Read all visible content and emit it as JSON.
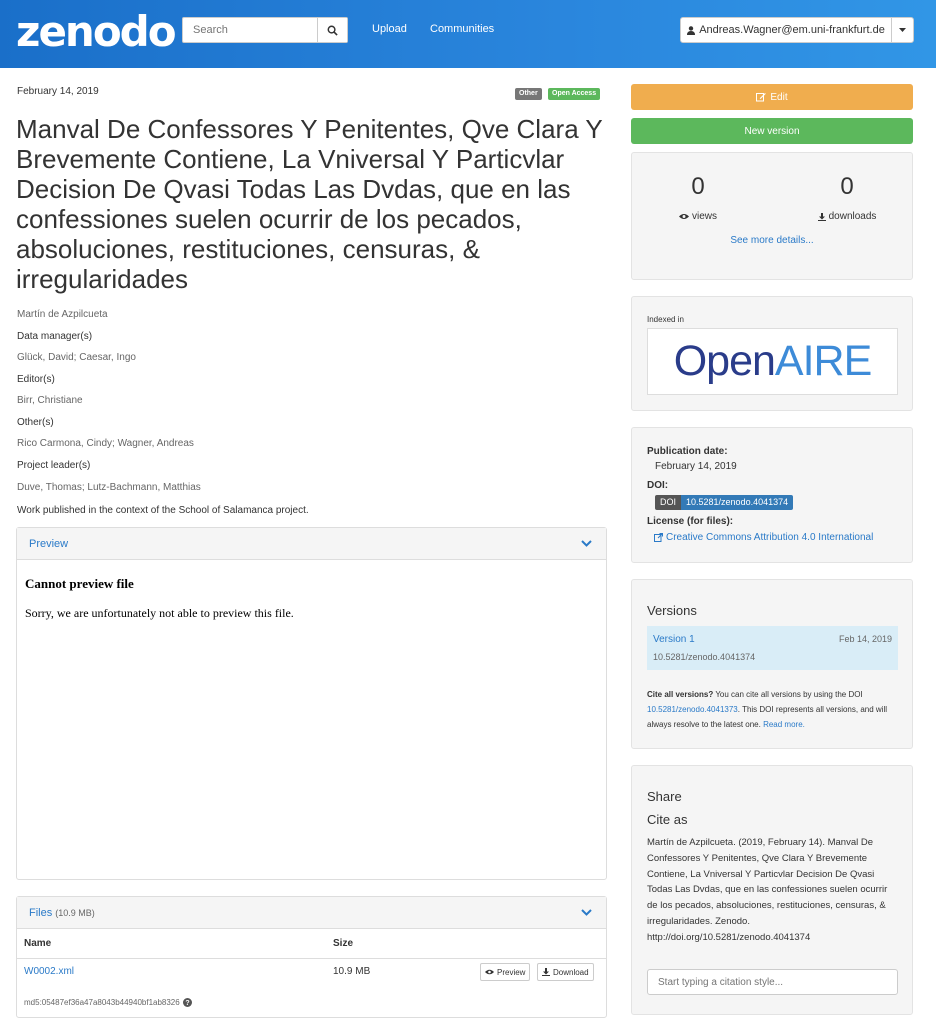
{
  "header": {
    "logo": "zenodo",
    "search_placeholder": "Search",
    "nav": [
      "Upload",
      "Communities"
    ],
    "user": "Andreas.Wagner@em.uni-frankfurt.de"
  },
  "record": {
    "date": "February 14, 2019",
    "badges": [
      {
        "label": "Other",
        "color": "#777777"
      },
      {
        "label": "Open Access",
        "color": "#5cb85c"
      }
    ],
    "title": "Manval De Confessores Y Penitentes, Qve Clara Y Brevemente Contiene, La Vniversal Y Particvlar Decision De Qvasi Todas Las Dvdas, que en las confessiones suelen ocurrir de los pecados, absoluciones, restituciones, censuras, & irregularidades",
    "author": "Martín de Azpilcueta",
    "roles": [
      {
        "label": "Data manager(s)",
        "names": "Glück, David; Caesar, Ingo"
      },
      {
        "label": "Editor(s)",
        "names": "Birr, Christiane"
      },
      {
        "label": "Other(s)",
        "names": "Rico Carmona, Cindy; Wagner, Andreas"
      },
      {
        "label": "Project leader(s)",
        "names": "Duve, Thomas; Lutz-Bachmann, Matthias"
      }
    ],
    "description": "Work published in the context of the School of Salamanca project."
  },
  "preview": {
    "heading": "Preview",
    "error_title": "Cannot preview file",
    "error_text": "Sorry, we are unfortunately not able to preview this file."
  },
  "files": {
    "heading": "Files",
    "size_note": "(10.9 MB)",
    "col_name": "Name",
    "col_size": "Size",
    "rows": [
      {
        "name": "W0002.xml",
        "size": "10.9 MB",
        "md5": "md5:05487ef36a47a8043b44940bf1ab8326",
        "preview_label": "Preview",
        "download_label": "Download"
      }
    ]
  },
  "sidebar": {
    "edit_label": "Edit",
    "new_version_label": "New version",
    "stats": {
      "views": "0",
      "views_label": "views",
      "downloads": "0",
      "downloads_label": "downloads",
      "more": "See more details..."
    },
    "indexed_in": "Indexed in",
    "openaire": {
      "open": "Open",
      "aire": "AIRE"
    },
    "pub_date_label": "Publication date:",
    "pub_date": "February 14, 2019",
    "doi_label": "DOI:",
    "doi_badge": "DOI",
    "doi": "10.5281/zenodo.4041374",
    "license_label": "License (for files):",
    "license": "Creative Commons Attribution 4.0 International",
    "versions_title": "Versions",
    "version": {
      "name": "Version 1",
      "date": "Feb 14, 2019",
      "doi": "10.5281/zenodo.4041374"
    },
    "cite_all_bold": "Cite all versions?",
    "cite_all_text1": " You can cite all versions by using the DOI ",
    "cite_all_doi": "10.5281/zenodo.4041373",
    "cite_all_text2": ". This DOI represents all versions, and will always resolve to the latest one. ",
    "read_more": "Read more.",
    "share_title": "Share",
    "cite_as_title": "Cite as",
    "citation": "Martín de Azpilcueta. (2019, February 14). Manval De Confessores Y Penitentes, Qve Clara Y Brevemente Contiene, La Vniversal Y Particvlar Decision De Qvasi Todas Las Dvdas, que en las confessiones suelen ocurrir de los pecados, absoluciones, restituciones, censuras, & irregularidades. Zenodo. http://doi.org/10.5281/zenodo.4041374",
    "citation_placeholder": "Start typing a citation style..."
  },
  "colors": {
    "nav": "#2a86dd",
    "link": "#2a7ac8",
    "edit": "#f0ad4e",
    "new_version": "#5cb85c",
    "doi": "#337ab7"
  }
}
